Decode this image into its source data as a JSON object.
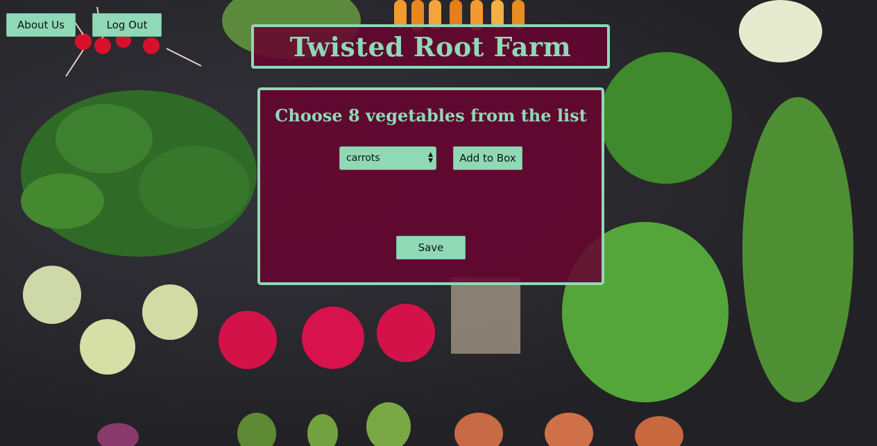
{
  "nav": {
    "about_label": "About Us",
    "logout_label": "Log Out"
  },
  "header": {
    "title": "Twisted Root Farm"
  },
  "main": {
    "heading": "Choose 8 vegetables from the list",
    "select_value": "carrots",
    "add_label": "Add to Box",
    "save_label": "Save"
  },
  "colors": {
    "accent": "#8fd9b6",
    "panel": "#680530",
    "background": "#222226"
  }
}
